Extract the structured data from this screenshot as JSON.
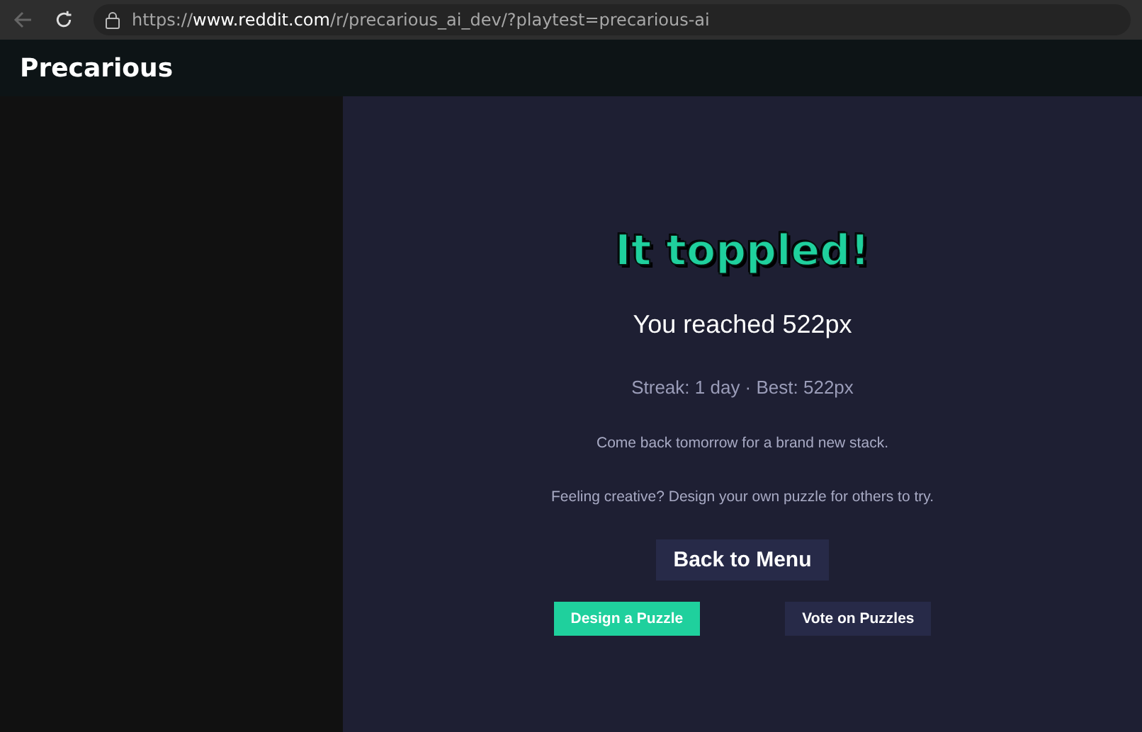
{
  "browser": {
    "url": "https://**www.reddit.com**/r/precarious_ai_dev/?playtest=precarious-ai"
  },
  "header": {
    "title": "Precarious"
  },
  "game": {
    "heading": "It toppled!",
    "result": "You reached 522px",
    "streak": "Streak: 1 day · Best: 522px",
    "message": "Come back tomorrow for a brand new stack.",
    "prompt": "Feeling creative? Design your own puzzle for others to try.",
    "main_button": "Back to Menu",
    "buttons": [
      {
        "label": "Design a Puzzle",
        "kind": "primary"
      },
      {
        "label": "Vote on Puzzles",
        "kind": "secondary"
      }
    ]
  }
}
